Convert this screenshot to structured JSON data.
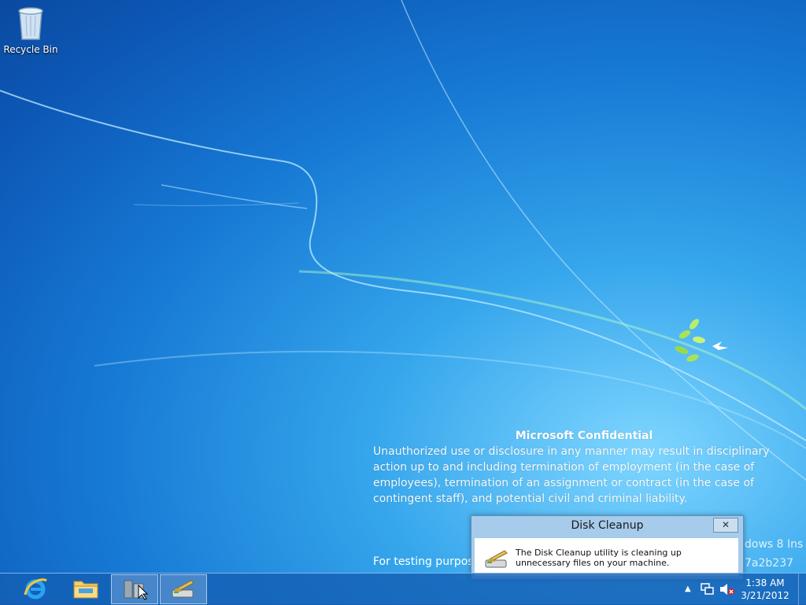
{
  "desktop": {
    "icons": [
      {
        "label": "Recycle Bin",
        "icon": "recycle-bin-icon"
      }
    ]
  },
  "watermark": {
    "title": "Microsoft Confidential",
    "body": "Unauthorized use or disclosure in any manner may result in disciplinary action up to and including termination of employment (in the case of employees), termination of an assignment or contract (in the case of contingent staff), and potential civil and criminal liability.",
    "testing_line": "For testing purpose",
    "right_fragment_1": "dows 8 Ins",
    "right_fragment_2": "7a2b237"
  },
  "dialog": {
    "title": "Disk Cleanup",
    "close_label": "✕",
    "message": "The Disk Cleanup utility is cleaning up unnecessary files on your machine.",
    "icon": "disk-cleanup-icon"
  },
  "taskbar": {
    "buttons": [
      {
        "name": "internet-explorer",
        "icon": "internet-explorer-icon",
        "active": false
      },
      {
        "name": "file-explorer",
        "icon": "folder-icon",
        "active": false
      },
      {
        "name": "server-manager",
        "icon": "server-manager-icon",
        "active": true
      },
      {
        "name": "disk-cleanup",
        "icon": "disk-cleanup-icon",
        "active": true
      }
    ],
    "tray": {
      "show_hidden_icon": "chevron-up-icon",
      "network_icon": "network-icon",
      "volume_icon": "volume-muted-icon"
    },
    "clock": {
      "time": "1:38 AM",
      "date": "3/21/2012"
    }
  },
  "colors": {
    "taskbar": "#145fb4",
    "dialog_frame": "#a6cbeb",
    "wallpaper_accent": "#7fd6ff"
  }
}
